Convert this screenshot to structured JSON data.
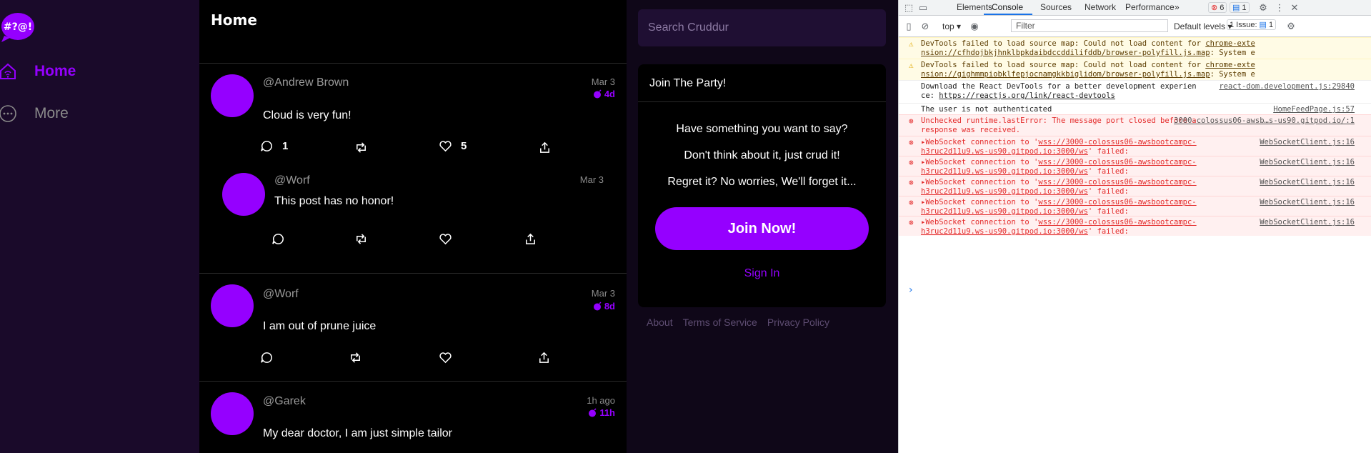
{
  "nav": {
    "logo_text": "#?@!",
    "items": [
      {
        "label": "Home"
      },
      {
        "label": "More"
      }
    ]
  },
  "feed": {
    "title": "Home",
    "activities": [
      {
        "handle": "@Andrew Brown",
        "date": "Mar 3",
        "expires": "4d",
        "message": "Cloud is very fun!",
        "replies": "1",
        "reposts": "",
        "likes": "5"
      },
      {
        "handle": "@Worf",
        "date": "Mar 3",
        "expires": "",
        "message": "This post has no honor!",
        "replies": "",
        "reposts": "",
        "likes": ""
      },
      {
        "handle": "@Worf",
        "date": "Mar 3",
        "expires": "8d",
        "message": "I am out of prune juice",
        "replies": "",
        "reposts": "",
        "likes": ""
      },
      {
        "handle": "@Garek",
        "date": "1h ago",
        "expires": "11h",
        "message": "My dear doctor, I am just simple tailor",
        "replies": "",
        "reposts": "",
        "likes": ""
      }
    ]
  },
  "search": {
    "placeholder": "Search Cruddur"
  },
  "join": {
    "title": "Join The Party!",
    "lines": [
      "Have something you want to say?",
      "Don't think about it, just crud it!",
      "Regret it? No worries, We'll forget it..."
    ],
    "button": "Join Now!",
    "signin": "Sign In"
  },
  "footer": {
    "links": [
      "About",
      "Terms of Service",
      "Privacy Policy"
    ]
  },
  "devtools": {
    "tabs": [
      "Elements",
      "Console",
      "Sources",
      "Network",
      "Performance"
    ],
    "more_tabs": "»",
    "error_count": "6",
    "message_count": "1",
    "context": "top",
    "filter_placeholder": "Filter",
    "levels": "Default levels",
    "issues": "1 Issue:",
    "issues_count": "1",
    "logs": [
      {
        "level": "warn",
        "text": "DevTools failed to load source map: Could not load content for ",
        "link": "chrome-extension://cfhdojbkjhnklbpkdaibdccddilifddb/browser-polyfill.js.map",
        "tail": ": System error: net::ERR_FILE_NOT_FOUND",
        "src": ""
      },
      {
        "level": "warn",
        "text": "DevTools failed to load source map: Could not load content for ",
        "link": "chrome-extension://gighmmpiobklfepjocnamgkkbiglidom/browser-polyfill.js.map",
        "tail": ": System error: net::ERR_FILE_NOT_FOUND",
        "src": ""
      },
      {
        "level": "info",
        "text": "Download the React DevTools for a better development experience: ",
        "link": "https://reactjs.org/link/react-devtools",
        "tail": "",
        "src": "react-dom.development.js:29840"
      },
      {
        "level": "info",
        "text": "The user is not authenticated",
        "link": "",
        "tail": "",
        "src": "HomeFeedPage.js:57"
      },
      {
        "level": "err",
        "text": "Unchecked runtime.lastError: The message port closed before a response was received.",
        "link": "",
        "tail": "",
        "src": "3000-colossus06-awsb…s-us90.gitpod.io/:1"
      },
      {
        "level": "err",
        "text": "▸WebSocket connection to '",
        "link": "wss://3000-colossus06-awsbootcampc-h3ruc2d11u9.ws-us90.gitpod.io:3000/ws",
        "tail": "' failed:",
        "src": "WebSocketClient.js:16"
      },
      {
        "level": "err",
        "text": "▸WebSocket connection to '",
        "link": "wss://3000-colossus06-awsbootcampc-h3ruc2d11u9.ws-us90.gitpod.io:3000/ws",
        "tail": "' failed:",
        "src": "WebSocketClient.js:16"
      },
      {
        "level": "err",
        "text": "▸WebSocket connection to '",
        "link": "wss://3000-colossus06-awsbootcampc-h3ruc2d11u9.ws-us90.gitpod.io:3000/ws",
        "tail": "' failed:",
        "src": "WebSocketClient.js:16"
      },
      {
        "level": "err",
        "text": "▸WebSocket connection to '",
        "link": "wss://3000-colossus06-awsbootcampc-h3ruc2d11u9.ws-us90.gitpod.io:3000/ws",
        "tail": "' failed:",
        "src": "WebSocketClient.js:16"
      },
      {
        "level": "err",
        "text": "▸WebSocket connection to '",
        "link": "wss://3000-colossus06-awsbootcampc-h3ruc2d11u9.ws-us90.gitpod.io:3000/ws",
        "tail": "' failed:",
        "src": "WebSocketClient.js:16"
      }
    ]
  },
  "colors": {
    "accent": "#9500ff",
    "nav_bg": "#1a0a2a",
    "feed_bg": "#000000"
  }
}
